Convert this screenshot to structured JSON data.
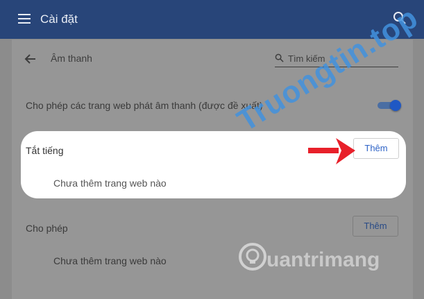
{
  "header": {
    "title": "Cài đặt",
    "menu_icon": "hamburger-menu-icon",
    "search_icon": "search-icon"
  },
  "section": {
    "title": "Âm thanh",
    "back_icon": "arrow-back-icon"
  },
  "search": {
    "placeholder": "Tìm kiếm"
  },
  "allow_sound": {
    "label": "Cho phép các trang web phát âm thanh (được đề xuất)",
    "enabled": true
  },
  "mute": {
    "title": "Tắt tiếng",
    "add_label": "Thêm",
    "empty_text": "Chưa thêm trang web nào"
  },
  "allow": {
    "title": "Cho phép",
    "add_label": "Thêm",
    "empty_text": "Chưa thêm trang web nào"
  },
  "colors": {
    "header": "#284579",
    "toggle": "#1f58c4",
    "button_text": "#2f64c7",
    "arrow": "#e8202a",
    "highlight": "#ffffff"
  },
  "watermarks": {
    "primary": "Truongtin.top",
    "secondary": "uantrimang"
  }
}
